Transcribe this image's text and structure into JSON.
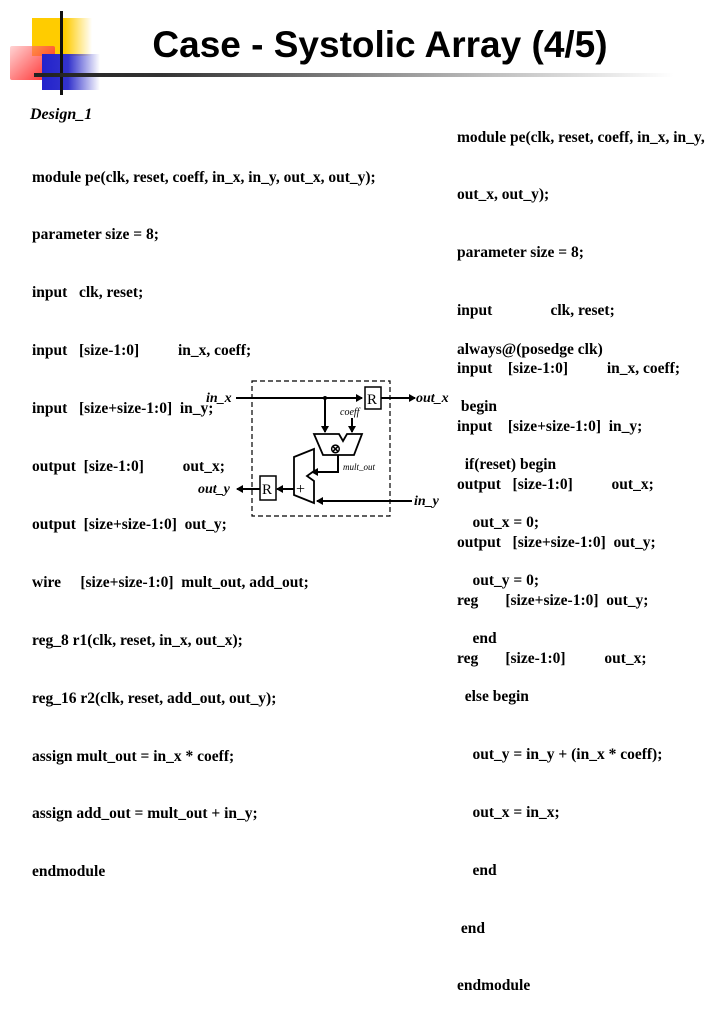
{
  "slide": {
    "title": "Case - Systolic Array (4/5)",
    "design_label": "Design_1"
  },
  "code_left": {
    "lines": [
      "module pe(clk, reset, coeff, in_x, in_y, out_x, out_y);",
      "parameter size = 8;",
      "input   clk, reset;",
      "input   [size-1:0]          in_x, coeff;",
      "input   [size+size-1:0]  in_y;",
      "output  [size-1:0]          out_x;",
      "output  [size+size-1:0]  out_y;",
      "wire     [size+size-1:0]  mult_out, add_out;",
      "reg_8 r1(clk, reset, in_x, out_x);",
      "reg_16 r2(clk, reset, add_out, out_y);",
      "assign mult_out = in_x * coeff;",
      "assign add_out = mult_out + in_y;",
      "endmodule"
    ]
  },
  "code_right": {
    "lines": [
      "module pe(clk, reset, coeff, in_x, in_y,",
      "out_x, out_y);",
      "parameter size = 8;",
      "input               clk, reset;",
      "input    [size-1:0]          in_x, coeff;",
      "input    [size+size-1:0]  in_y;",
      "output   [size-1:0]          out_x;",
      "output   [size+size-1:0]  out_y;",
      "reg       [size+size-1:0]  out_y;",
      "reg       [size-1:0]          out_x;"
    ],
    "always_lines": [
      "always@(posedge clk)",
      " begin",
      "  if(reset) begin",
      "    out_x = 0;",
      "    out_y = 0;",
      "    end",
      "  else begin",
      "    out_y = in_y + (in_x * coeff);",
      "    out_x = in_x;",
      "    end",
      " end",
      "endmodule"
    ]
  },
  "diagram": {
    "labels": {
      "in_x": "in_x",
      "out_x": "out_x",
      "out_y": "out_y",
      "in_y": "in_y",
      "coeff": "coeff",
      "mult_out": "mult_out",
      "reg_top": "R",
      "reg_bottom": "R",
      "adder": "+",
      "multiplier": "⊗"
    }
  },
  "colors": {
    "logo_yellow": "#ffcc00",
    "logo_red": "#ff2020",
    "logo_blue": "#2222cc",
    "text": "#000000"
  }
}
